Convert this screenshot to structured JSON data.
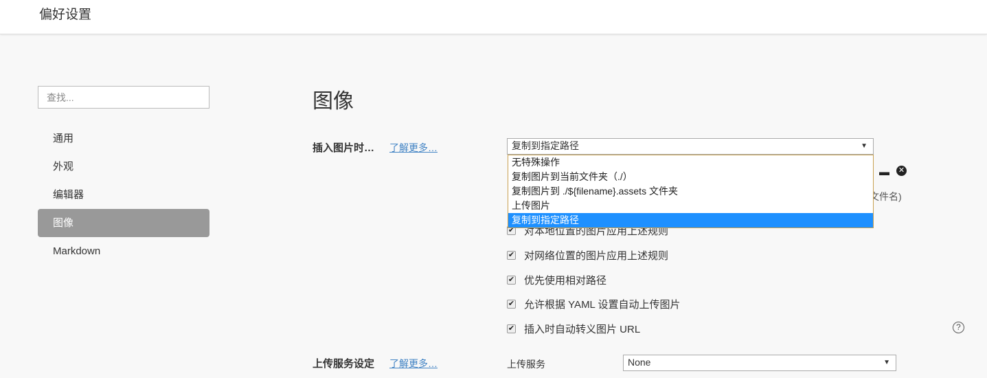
{
  "header": {
    "title": "偏好设置"
  },
  "sidebar": {
    "search_placeholder": "查找...",
    "items": [
      {
        "label": "通用"
      },
      {
        "label": "外观"
      },
      {
        "label": "编辑器"
      },
      {
        "label": "图像"
      },
      {
        "label": "Markdown"
      }
    ]
  },
  "main": {
    "heading": "图像",
    "insert": {
      "label": "插入图片时…",
      "learn_more": "了解更多…",
      "selected": "复制到指定路径",
      "options": [
        "无特殊操作",
        "复制图片到当前文件夹（./）",
        "复制图片到 ./${filename}.assets 文件夹",
        "上传图片",
        "复制到指定路径"
      ],
      "hint_fragment": "文件名)"
    },
    "checkboxes": [
      {
        "label": "对本地位置的图片应用上述规则",
        "checked": true
      },
      {
        "label": "对网络位置的图片应用上述规则",
        "checked": true
      },
      {
        "label": "优先使用相对路径",
        "checked": true
      },
      {
        "label": "允许根据 YAML 设置自动上传图片",
        "checked": true
      },
      {
        "label": "插入时自动转义图片 URL",
        "checked": true
      }
    ],
    "upload": {
      "label": "上传服务设定",
      "learn_more": "了解更多…",
      "service_label": "上传服务",
      "service_value": "None"
    }
  }
}
